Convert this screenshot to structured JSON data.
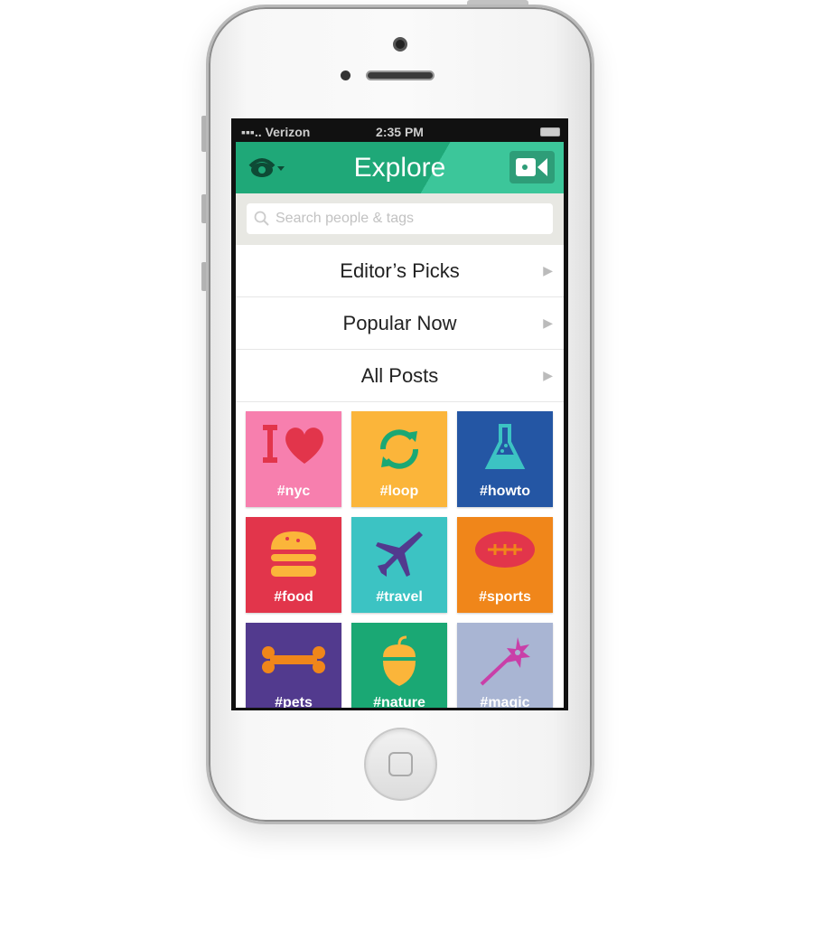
{
  "status_bar": {
    "carrier": "Verizon",
    "time": "2:35 PM"
  },
  "nav": {
    "title": "Explore",
    "left_icon": "eye-icon",
    "right_icon": "video-camera-icon",
    "color": "#1fa878"
  },
  "search": {
    "placeholder": "Search people & tags"
  },
  "menu": [
    {
      "label": "Editor’s Picks"
    },
    {
      "label": "Popular Now"
    },
    {
      "label": "All Posts"
    }
  ],
  "tiles": [
    {
      "label": "#nyc",
      "color": "#f77fae",
      "icon": "i-love-heart-icon"
    },
    {
      "label": "#loop",
      "color": "#fbb53a",
      "icon": "loop-arrows-icon"
    },
    {
      "label": "#howto",
      "color": "#2456a4",
      "icon": "flask-icon"
    },
    {
      "label": "#food",
      "color": "#e2354b",
      "icon": "burger-icon"
    },
    {
      "label": "#travel",
      "color": "#3cc3c3",
      "icon": "airplane-icon"
    },
    {
      "label": "#sports",
      "color": "#f0861a",
      "icon": "football-icon"
    },
    {
      "label": "#pets",
      "color": "#523a8e",
      "icon": "bone-icon"
    },
    {
      "label": "#nature",
      "color": "#1aa874",
      "icon": "acorn-icon"
    },
    {
      "label": "#magic",
      "color": "#a9b5d3",
      "icon": "magic-wand-icon"
    }
  ]
}
